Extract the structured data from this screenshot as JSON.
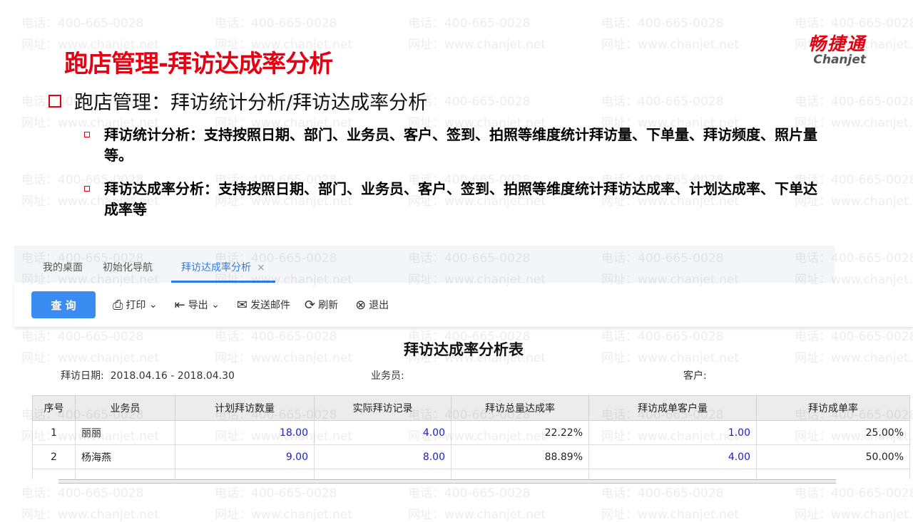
{
  "watermark": {
    "phone": "电话：400-665-0028",
    "site": "网址：www.chanjet.net"
  },
  "slide": {
    "title": "跑店管理-拜访达成率分析",
    "logo_cn": "畅捷通",
    "logo_en": "Chanjet",
    "bullet": "跑店管理：拜访统计分析/拜访达成率分析",
    "sub1": "拜访统计分析：支持按照日期、部门、业务员、客户、签到、拍照等维度统计拜访量、下单量、拜访频度、照片量等。",
    "sub2": "拜访达成率分析：支持按照日期、部门、业务员、客户、签到、拍照等维度统计拜访达成率、计划达成率、下单达成率等"
  },
  "app": {
    "tabs": [
      {
        "label": "我的桌面"
      },
      {
        "label": "初始化导航"
      },
      {
        "label": "拜访达成率分析",
        "close": "×"
      }
    ],
    "toolbar": {
      "query": "查 询",
      "print": "打印",
      "export": "导出",
      "email": "发送邮件",
      "refresh": "刷新",
      "exit": "退出"
    },
    "report_title": "拜访达成率分析表",
    "filters": {
      "date_label": "拜访日期:",
      "date_value": "2018.04.16 - 2018.04.30",
      "salesman_label": "业务员:",
      "customer_label": "客户:"
    },
    "table": {
      "headers": [
        "序号",
        "业务员",
        "计划拜访数量",
        "实际拜访记录",
        "拜访总量达成率",
        "拜访成单客户量",
        "拜访成单率"
      ],
      "rows": [
        [
          "1",
          "丽丽",
          "18.00",
          "4.00",
          "22.22%",
          "1.00",
          "25.00%"
        ],
        [
          "2",
          "杨海燕",
          "9.00",
          "8.00",
          "88.89%",
          "4.00",
          "50.00%"
        ]
      ]
    }
  }
}
